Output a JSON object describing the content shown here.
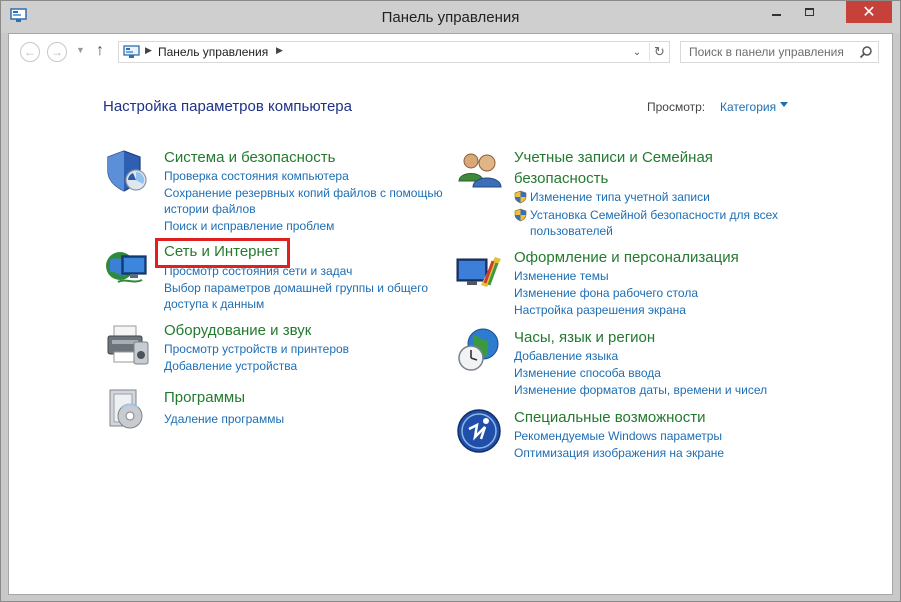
{
  "window": {
    "title": "Панель управления"
  },
  "address": {
    "path": "Панель управления",
    "search_placeholder": "Поиск в панели управления"
  },
  "main": {
    "heading": "Настройка параметров компьютера",
    "view_label": "Просмотр:",
    "view_value": "Категория"
  },
  "categories": {
    "system": {
      "title": "Система и безопасность",
      "links": [
        "Проверка состояния компьютера",
        "Сохранение резервных копий файлов с помощью",
        "истории файлов",
        "Поиск и исправление проблем"
      ]
    },
    "network": {
      "title": "Сеть и Интернет",
      "links": [
        "Просмотр состояния сети и задач",
        "Выбор параметров домашней группы и общего",
        "доступа к данным"
      ]
    },
    "hardware": {
      "title": "Оборудование и звук",
      "links": [
        "Просмотр устройств и принтеров",
        "Добавление устройства"
      ]
    },
    "programs": {
      "title": "Программы",
      "links": [
        "Удаление программы"
      ]
    },
    "accounts": {
      "title_line1": "Учетные записи и Семейная",
      "title_line2": "безопасность",
      "links": [
        "Изменение типа учетной записи",
        "Установка Семейной безопасности для всех",
        "пользователей"
      ]
    },
    "appearance": {
      "title": "Оформление и персонализация",
      "links": [
        "Изменение темы",
        "Изменение фона рабочего стола",
        "Настройка разрешения экрана"
      ]
    },
    "clock": {
      "title": "Часы, язык и регион",
      "links": [
        "Добавление языка",
        "Изменение способа ввода",
        "Изменение форматов даты, времени и чисел"
      ]
    },
    "access": {
      "title": "Специальные возможности",
      "links": [
        "Рекомендуемые Windows параметры",
        "Оптимизация изображения на экране"
      ]
    }
  },
  "colors": {
    "title_green": "#237a2f",
    "link_blue": "#1e6eb4",
    "heading_blue": "#1e3287",
    "highlight_red": "#e0201f",
    "close_red": "#c7413b"
  }
}
